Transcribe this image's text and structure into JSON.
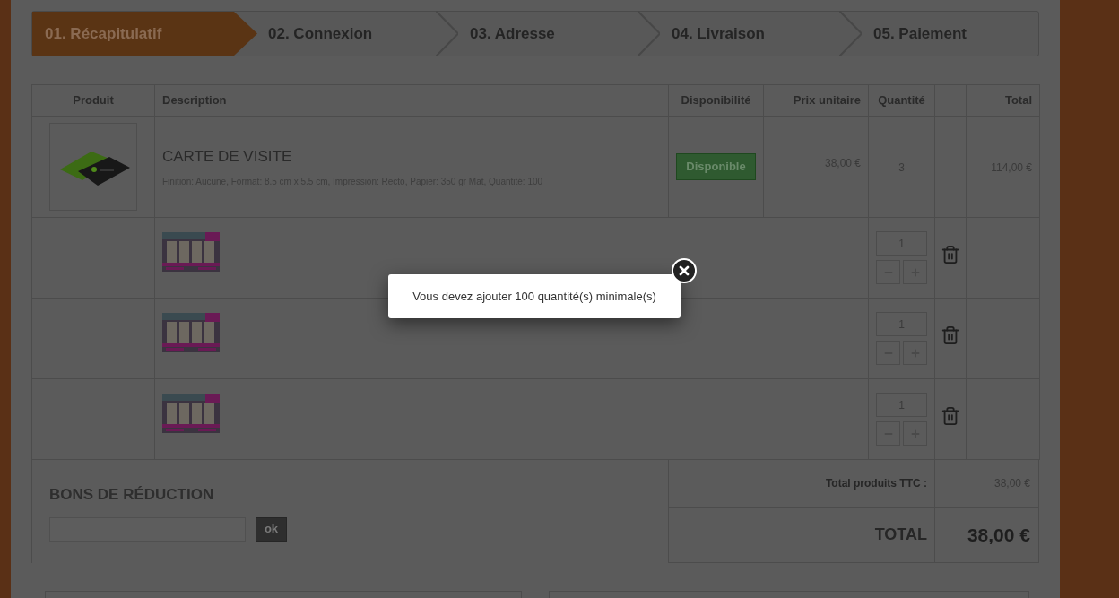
{
  "steps": [
    {
      "label": "01. Récapitulatif",
      "selected": true
    },
    {
      "label": "02. Connexion",
      "selected": false
    },
    {
      "label": "03. Adresse",
      "selected": false
    },
    {
      "label": "04. Livraison",
      "selected": false
    },
    {
      "label": "05. Paiement",
      "selected": false
    }
  ],
  "table": {
    "columns": [
      "Produit",
      "Description",
      "Disponibilité",
      "Prix unitaire",
      "Quantité",
      "Total"
    ],
    "rows": [
      {
        "kind": "product",
        "name": "CARTE DE VISITE",
        "details": "Finition: Aucune, Format: 8.5 cm x 5.5 cm, Impression: Recto, Papier: 350 gr Mat, Quantité: 100",
        "availability": "Disponible",
        "unit_price": "38,00 €",
        "quantity": "3",
        "total": "114,00 €"
      },
      {
        "kind": "extra",
        "quantity": "1"
      },
      {
        "kind": "extra",
        "quantity": "1"
      },
      {
        "kind": "extra",
        "quantity": "1"
      }
    ]
  },
  "voucher": {
    "title": "BONS DE RÉDUCTION",
    "button": "ok"
  },
  "totals": [
    {
      "kind": "subtotal",
      "label": "Total produits TTC :",
      "value": "38,00 €"
    },
    {
      "kind": "grand",
      "label": "TOTAL",
      "value": "38,00 €"
    }
  ],
  "popup": {
    "message": "Vous devez ajouter 100 quantité(s) minimale(s)"
  }
}
